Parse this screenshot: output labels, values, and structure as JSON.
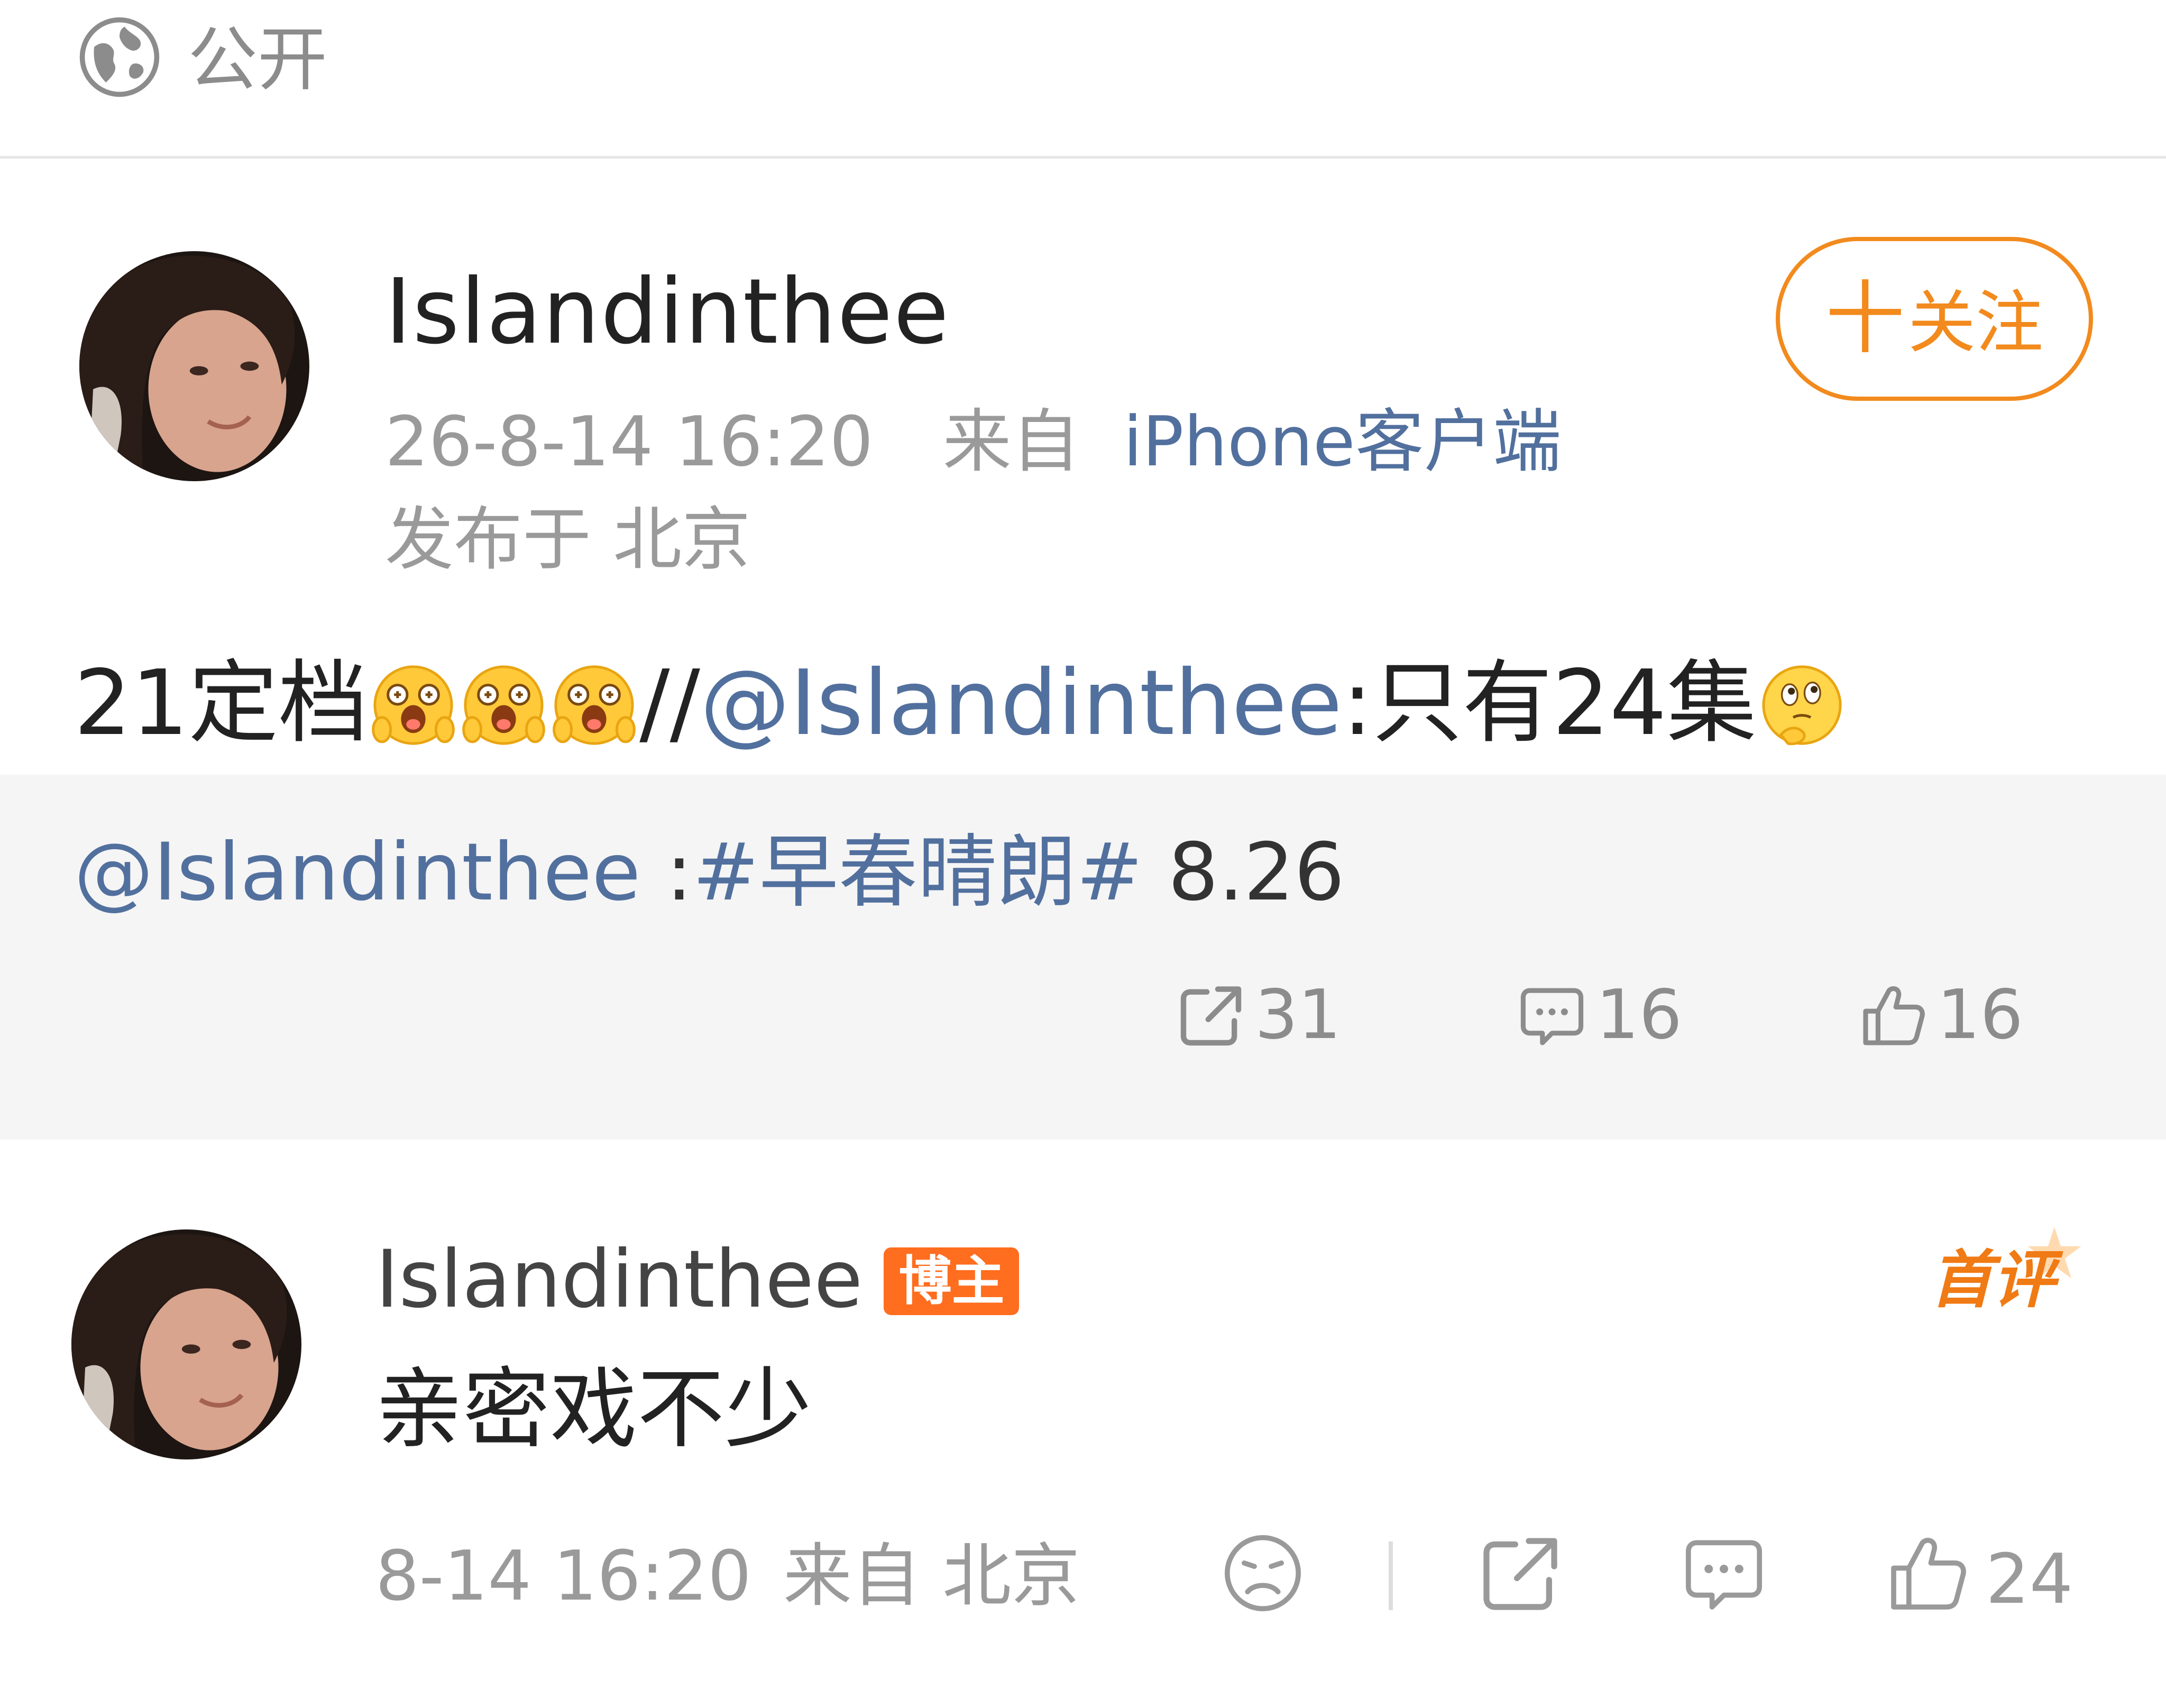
{
  "visibility": {
    "icon": "globe-icon",
    "label": "公开"
  },
  "post": {
    "author": "Islandinthee",
    "timestamp": "26-8-14 16:20",
    "source_prefix": "来自",
    "source_app": "iPhone客户端",
    "location": "发布于 北京",
    "follow_button": {
      "plus": "十",
      "label": "关注"
    },
    "text_before": "21定档",
    "emojis_first": [
      "excited-emoji",
      "excited-emoji",
      "excited-emoji"
    ],
    "separator": "//",
    "mention": "@Islandinthee",
    "text_after": ":只有24集",
    "emoji_last": "thinking-emoji"
  },
  "quote": {
    "mention": "@Islandinthee",
    "colon": " :",
    "topic": "#早春晴朗#",
    "plain": " 8.26",
    "actions": {
      "repost_count": "31",
      "comment_count": "16",
      "like_count": "16"
    }
  },
  "comment": {
    "author": "Islandinthee",
    "badge": "博主",
    "first_comment_label": "首评",
    "text": "亲密戏不少",
    "timestamp": "8-14 16:20",
    "source": "来自 北京",
    "like_count": "24"
  },
  "colors": {
    "accent_orange": "#f28a1d",
    "link_blue": "#52709e",
    "badge_orange": "#ff6d1f",
    "muted_gray": "#9a9a9a",
    "quote_background": "#f5f5f5"
  }
}
